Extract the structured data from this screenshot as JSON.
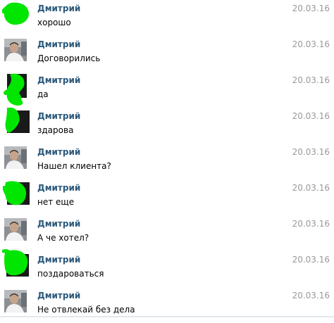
{
  "colors": {
    "sender": "#2b587a",
    "date": "#999999",
    "text": "#000000",
    "scribble": "#00e600"
  },
  "messages": [
    {
      "sender": "Дмитрий",
      "date": "20.03.16",
      "text": "хорошо",
      "avatar": "scribble-1"
    },
    {
      "sender": "Дмитрий",
      "date": "20.03.16",
      "text": "Договорились",
      "avatar": "photo"
    },
    {
      "sender": "Дмитрий",
      "date": "20.03.16",
      "text": "да",
      "avatar": "scribble-2"
    },
    {
      "sender": "Дмитрий",
      "date": "20.03.16",
      "text": "здарова",
      "avatar": "scribble-3"
    },
    {
      "sender": "Дмитрий",
      "date": "20.03.16",
      "text": "Нашел клиента?",
      "avatar": "photo"
    },
    {
      "sender": "Дмитрий",
      "date": "20.03.16",
      "text": "нет еще",
      "avatar": "scribble-4"
    },
    {
      "sender": "Дмитрий",
      "date": "20.03.16",
      "text": "А че хотел?",
      "avatar": "photo"
    },
    {
      "sender": "Дмитрий",
      "date": "20.03.16",
      "text": "поздароваться",
      "avatar": "scribble-5"
    },
    {
      "sender": "Дмитрий",
      "date": "20.03.16",
      "text": "Не отвлекай без дела",
      "avatar": "photo"
    }
  ]
}
